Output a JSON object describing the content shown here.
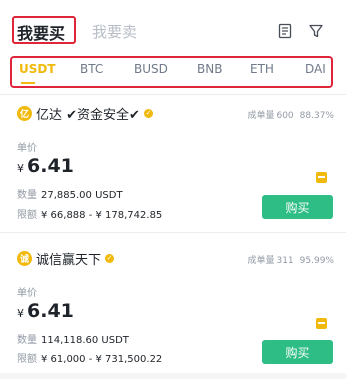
{
  "header": {
    "tab_buy": "我要买",
    "tab_sell": "我要卖",
    "icons": [
      "orders-icon",
      "filter-icon"
    ]
  },
  "coins": [
    "USDT",
    "BTC",
    "BUSD",
    "BNB",
    "ETH",
    "DAI"
  ],
  "active_coin": "USDT",
  "colors": {
    "accent": "#f0b90b",
    "buy": "#2ebd85",
    "highlight": "#e0253b"
  },
  "ads": [
    {
      "merchant": "亿达 ✔资金安全✔",
      "avatar": "亿",
      "orders_label": "成单量",
      "orders": "600",
      "completion": "88.37%",
      "price_label": "单价",
      "currency": "¥",
      "price": "6.41",
      "qty_label": "数量",
      "qty": "27,885.00 USDT",
      "limit_label": "限额",
      "limit": "¥ 66,888 - ¥ 178,742.85",
      "buy_label": "购买"
    },
    {
      "merchant": "诚信赢天下",
      "avatar": "诚",
      "orders_label": "成单量",
      "orders": "311",
      "completion": "95.99%",
      "price_label": "单价",
      "currency": "¥",
      "price": "6.41",
      "qty_label": "数量",
      "qty": "114,118.60 USDT",
      "limit_label": "限额",
      "limit": "¥ 61,000 - ¥ 731,500.22",
      "buy_label": "购买"
    }
  ]
}
